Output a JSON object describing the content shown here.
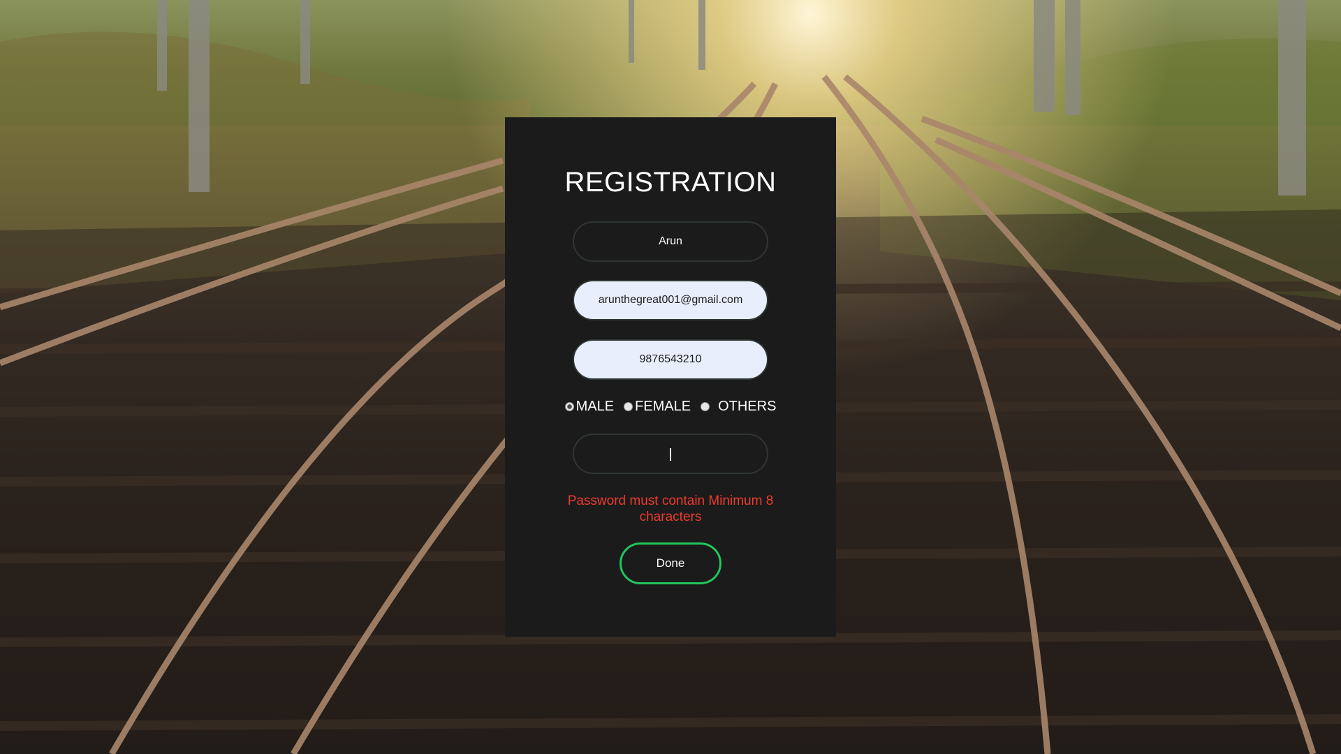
{
  "form": {
    "title": "REGISTRATION",
    "name_value": "Arun",
    "email_value": "arunthegreat001@gmail.com",
    "phone_value": "9876543210",
    "password_value": "",
    "gender_options": [
      "MALE",
      "FEMALE",
      "OTHERS"
    ],
    "gender_selected": "MALE",
    "error_message": "Password must contain Minimum 8 characters",
    "done_label": "Done"
  },
  "colors": {
    "card_background": "#1b1b1b",
    "error": "#ef3b2f",
    "button_border": "#22c55e",
    "autofill_input": "#e8eefc"
  },
  "background": {
    "description_icon": "railway-tracks-photo"
  }
}
